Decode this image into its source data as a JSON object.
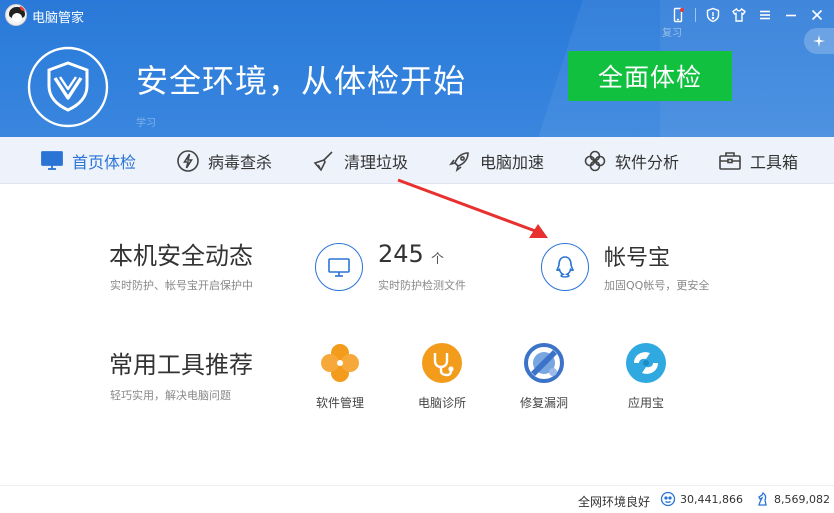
{
  "window": {
    "title": "电脑管家",
    "faint_label": "复习",
    "faint_label2": "学习"
  },
  "hero": {
    "slogan": "安全环境，从体检开始",
    "scan_button": "全面体检"
  },
  "nav": [
    {
      "label": "首页体检",
      "icon": "monitor-icon",
      "active": true
    },
    {
      "label": "病毒查杀",
      "icon": "bolt-icon",
      "active": false
    },
    {
      "label": "清理垃圾",
      "icon": "broom-icon",
      "active": false
    },
    {
      "label": "电脑加速",
      "icon": "rocket-icon",
      "active": false
    },
    {
      "label": "软件分析",
      "icon": "clover-icon",
      "active": false
    },
    {
      "label": "工具箱",
      "icon": "toolbox-icon",
      "active": false
    }
  ],
  "security": {
    "title": "本机安全动态",
    "subtitle": "实时防护、帐号宝开启保护中",
    "count": "245",
    "count_unit": "个",
    "count_desc": "实时防护检测文件",
    "account_title": "帐号宝",
    "account_desc": "加固QQ帐号，更安全"
  },
  "tools": {
    "title": "常用工具推荐",
    "subtitle": "轻巧实用，解决电脑问题",
    "items": [
      {
        "label": "软件管理",
        "icon": "software-manager-icon",
        "color": "#f39c1b"
      },
      {
        "label": "电脑诊所",
        "icon": "stethoscope-icon",
        "color": "#f39c1b"
      },
      {
        "label": "修复漏洞",
        "icon": "repair-icon",
        "color": "#3b73c9"
      },
      {
        "label": "应用宝",
        "icon": "app-store-icon",
        "color": "#2fa9e0"
      }
    ]
  },
  "footer": {
    "env_status": "全网环境良好",
    "stat1": "30,441,866",
    "stat2": "8,569,082"
  },
  "colors": {
    "header": "#2f7fdc",
    "accent": "#2a74d6",
    "scan_button": "#12c03f",
    "arrow": "#e8302e"
  }
}
